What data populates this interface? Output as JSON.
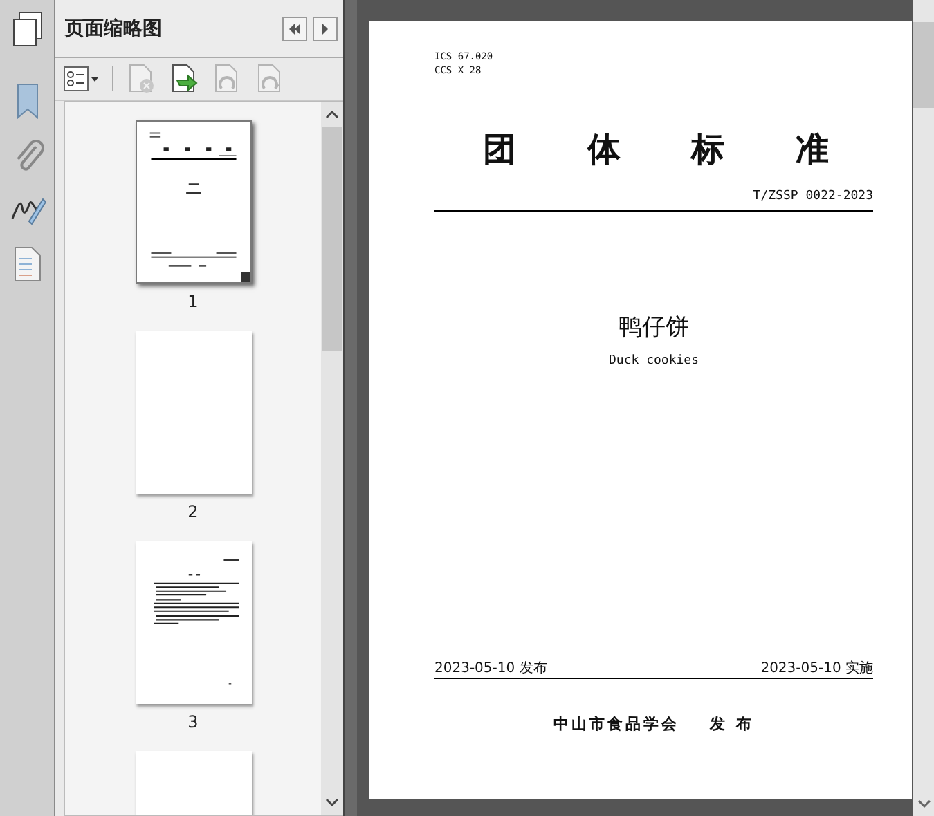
{
  "panel": {
    "title": "页面缩略图"
  },
  "toolbar": [
    {
      "kind": "delete",
      "disabled": true
    },
    {
      "kind": "insert",
      "disabled": false
    },
    {
      "kind": "undo",
      "disabled": true
    },
    {
      "kind": "redo",
      "disabled": true
    }
  ],
  "thumbnails": [
    {
      "label": "1",
      "kind": "cover",
      "selected": true
    },
    {
      "label": "2",
      "kind": "blank",
      "selected": false
    },
    {
      "label": "3",
      "kind": "text",
      "selected": false
    },
    {
      "kind": "blank",
      "selected": false
    }
  ],
  "document": {
    "ics": "ICS 67.020",
    "ccs": "CCS X 28",
    "heading": [
      "团",
      "体",
      "标",
      "准"
    ],
    "code": "T/ZSSP 0022-2023",
    "title": "鸭仔饼",
    "subtitle": "Duck cookies",
    "issue_date": "2023-05-10 发布",
    "effective_date": "2023-05-10 实施",
    "publisher": "中山市食品学会",
    "publisher_action": "发 布"
  }
}
